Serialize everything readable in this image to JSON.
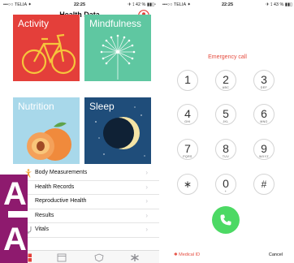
{
  "left_phone": {
    "status_bar": {
      "carrier": "•••○○ TELIA ✦",
      "time": "22:25",
      "battery": "✈ ⟟ 42 % ▮▮▯▫"
    },
    "title": "Health Data",
    "tiles": {
      "activity": "Activity",
      "mindfulness": "Mindfulness",
      "nutrition": "Nutrition",
      "sleep": "Sleep"
    },
    "list": [
      {
        "label": "Body Measurements",
        "icon": "body-figure-icon"
      },
      {
        "label": "Health Records",
        "icon": ""
      },
      {
        "label": "Reproductive Health",
        "icon": ""
      },
      {
        "label": "Results",
        "icon": ""
      },
      {
        "label": "Vitals",
        "icon": "stethoscope-icon"
      }
    ],
    "chevron": "›",
    "tabbar_icons": [
      "health-data-icon",
      "today-icon",
      "sources-icon",
      "medical-id-icon"
    ],
    "overlay_letters": [
      "A",
      "A"
    ]
  },
  "right_phone": {
    "status_bar": {
      "carrier": "•••○○ TELIA ✦",
      "time": "22:25",
      "battery": "✈ ⟟ 43 % ▮▮▯"
    },
    "emergency_label": "Emergency call",
    "keys": [
      {
        "digit": "1",
        "letters": ""
      },
      {
        "digit": "2",
        "letters": "ABC"
      },
      {
        "digit": "3",
        "letters": "DEF"
      },
      {
        "digit": "4",
        "letters": "GHI"
      },
      {
        "digit": "5",
        "letters": "JKL"
      },
      {
        "digit": "6",
        "letters": "MNO"
      },
      {
        "digit": "7",
        "letters": "PQRS"
      },
      {
        "digit": "8",
        "letters": "TUV"
      },
      {
        "digit": "9",
        "letters": "WXYZ"
      },
      {
        "digit": "∗",
        "letters": ""
      },
      {
        "digit": "0",
        "letters": "+"
      },
      {
        "digit": "#",
        "letters": ""
      }
    ],
    "medical_id": "✱ Medical ID",
    "cancel": "Cancel"
  },
  "colors": {
    "activity": "#e43f3a",
    "mindfulness": "#5fc7a1",
    "nutrition": "#a8d8ea",
    "sleep": "#1f4d7a",
    "accent_red": "#e54b3e",
    "call_green": "#4cd964",
    "overlay_magenta": "#8e1a6e"
  }
}
